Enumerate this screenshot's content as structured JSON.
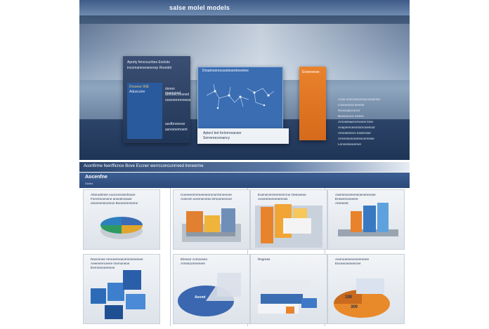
{
  "header": {
    "title": "salse molel models"
  },
  "hero": {
    "left_panel_lines": [
      "Aporty fencoucrbes Evelots",
      "incomamnenenerep Roredel"
    ],
    "left_panel_sub": [
      "Drsoner 00E",
      "Aduscuire"
    ],
    "left_panel_right": [
      "dvmm maerseed",
      "anmeecnnsned",
      "ouvesnnreveess"
    ],
    "left_panel_bottom": [
      "assfbnonese",
      "asresnemoent"
    ],
    "center_title": "Drsamoonocosetooretoooriee",
    "white_panel_lines": [
      "Aptect bot forlorresanser",
      "Serrereecenancy"
    ],
    "orange_title": "Eraneeeoe",
    "right_list": [
      "Aoss erscorsecreveccesemer",
      "Lossoenocnsereor",
      "Reneoderrorrer",
      "Beesenoce errere",
      "Aroosesaecerscses lone",
      "Anepereceeoriomonesoor",
      "Aeresesrecs esseroser",
      "Arreresonoreesncerresse",
      "Lonnesseoerner"
    ]
  },
  "subtitle": "Aconfirme feenfficnce Bove Eccner werrcconcunrreed trereerme",
  "section": {
    "title": "Aocenfne",
    "sub": "Slated"
  },
  "cards": [
    {
      "caption": [
        "Aborodnmie Auocereotonhrane",
        "Forrerenenene ameotronane",
        "omennentoomon Boonerenmene"
      ],
      "chart": "pie"
    },
    {
      "caption": [
        "Coreeeremrmeeneoronorremoreoer",
        "Aoscem eorenenreso Dmooreenoor"
      ],
      "chart": "bars3d"
    },
    {
      "caption": [
        "Eoenenorrerereenrcne Oeeveeoe",
        "Aoceremeneoereoss"
      ],
      "chart": "bars-orange"
    },
    {
      "caption": [
        "Aaresnsceeemeoenerenoee",
        "Erosenrceneere",
        "Aereeeet"
      ],
      "chart": "bars-blue"
    },
    {
      "caption": [
        "Raceonee rereoerreoeormmemenee",
        "Aeeesrenceere memoneoe",
        "Eernreoneremne"
      ],
      "chart": "cubes"
    },
    {
      "caption": [
        "Eleosor cnmoceeo",
        "Arreotoorreeneer"
      ],
      "chart": "pie-blue",
      "label": "Aeomt"
    },
    {
      "caption": [
        "Regreas"
      ],
      "chart": "panels"
    },
    {
      "caption": [
        "Aeorooemecenenreeee",
        "Eeceeoneneeroer"
      ],
      "chart": "pie-orange",
      "labels": [
        "100",
        "300"
      ]
    }
  ],
  "colors": {
    "accent_blue": "#2d5fa8",
    "accent_orange": "#e9822c",
    "accent_green": "#2e9a62",
    "header_navy": "#2c4a79"
  }
}
